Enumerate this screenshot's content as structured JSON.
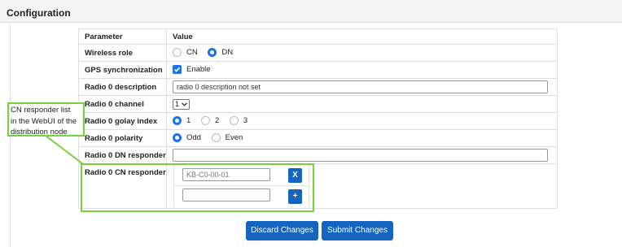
{
  "header": {
    "title": "Configuration"
  },
  "table": {
    "col_parameter": "Parameter",
    "col_value": "Value",
    "rows": {
      "wireless_role": {
        "label": "Wireless role",
        "options": [
          "CN",
          "DN"
        ],
        "selected": "DN"
      },
      "gps": {
        "label": "GPS synchronization",
        "checkbox_label": "Enable",
        "checked": true
      },
      "radio0_description": {
        "label": "Radio 0 description",
        "value": "radio 0 description not set"
      },
      "radio0_channel": {
        "label": "Radio 0 channel",
        "value": "1"
      },
      "radio0_golay": {
        "label": "Radio 0 golay index",
        "options": [
          "1",
          "2",
          "3"
        ],
        "selected": "1"
      },
      "radio0_polarity": {
        "label": "Radio 0 polarity",
        "options": [
          "Odd",
          "Even"
        ],
        "selected": "Odd"
      },
      "radio0_dn_responder": {
        "label": "Radio 0 DN responder",
        "value": ""
      },
      "radio0_cn_responder": {
        "label": "Radio 0 CN responder",
        "entries": [
          {
            "value": "",
            "placeholder": "KB-C0-00-01",
            "button": "X"
          },
          {
            "value": "",
            "placeholder": "",
            "button": "+"
          }
        ]
      }
    }
  },
  "buttons": {
    "discard": "Discard Changes",
    "submit": "Submit Changes"
  },
  "callout": {
    "text": "CN responder list\nin the WebUI of the\ndistribution node"
  },
  "colors": {
    "accent": "#1565c0",
    "radio_checked": "#1a73e8",
    "highlight": "#76d23b"
  }
}
